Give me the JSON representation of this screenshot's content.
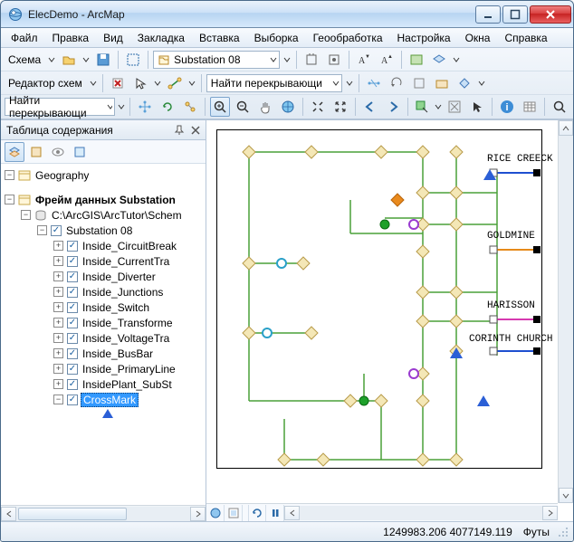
{
  "window": {
    "title": "ElecDemo - ArcMap"
  },
  "menu": {
    "file": "Файл",
    "edit": "Правка",
    "view": "Вид",
    "bookmarks": "Закладка",
    "insert": "Вставка",
    "selection": "Выборка",
    "geoprocessing": "Геообработка",
    "customize": "Настройка",
    "windows": "Окна",
    "help": "Справка"
  },
  "toolbar1": {
    "schema_label": "Схема",
    "substation_combo": "Substation 08"
  },
  "toolbar2": {
    "editor_label": "Редактор схем",
    "find_combo": "Найти перекрывающи"
  },
  "toolbar3": {
    "find_combo": "Найти перекрывающи"
  },
  "toc": {
    "title": "Таблица содержания",
    "geography": "Geography",
    "dataframe": "Фрейм данных Substation",
    "gdb": "C:\\ArcGIS\\ArcTutor\\Schem",
    "dataset": "Substation 08",
    "layers": [
      "Inside_CircuitBreak",
      "Inside_CurrentTra",
      "Inside_Diverter",
      "Inside_Junctions",
      "Inside_Switch",
      "Inside_Transforme",
      "Inside_VoltageTra",
      "Inside_BusBar",
      "Inside_PrimaryLine",
      "InsidePlant_SubSt",
      "CrossMark"
    ]
  },
  "map": {
    "labels": {
      "rice": "RICE CREECK",
      "gold": "GOLDMINE",
      "harisson": "HARISSON",
      "corinth": "CORINTH CHURCH"
    }
  },
  "status": {
    "coords": "1249983.206 4077149.119",
    "units": "Футы"
  }
}
